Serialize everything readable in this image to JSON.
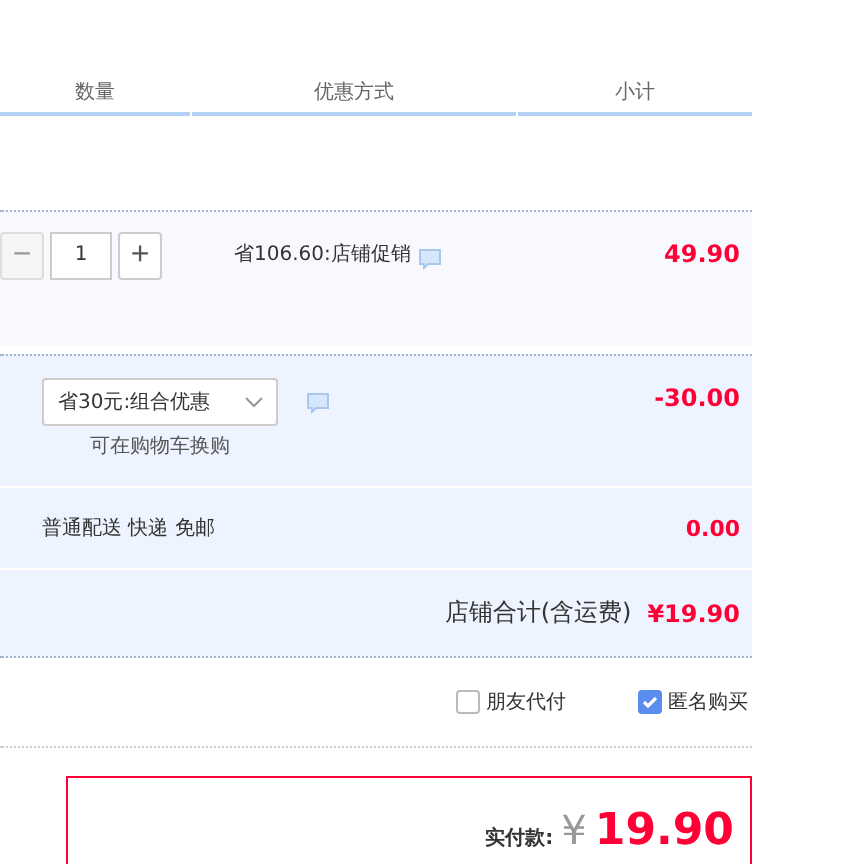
{
  "columns": [
    {
      "label": "数量"
    },
    {
      "label": "优惠方式"
    },
    {
      "label": "小计"
    }
  ],
  "item": {
    "minus": "−",
    "quantity": "1",
    "plus": "+",
    "minus_disabled": true,
    "promo": "省106.60:店铺促销",
    "subtotal": "49.90"
  },
  "combo": {
    "selection": "省30元:组合优惠",
    "note": "可在购物车换购",
    "amount": "-30.00"
  },
  "shipping": {
    "label": "普通配送 快递 免邮",
    "amount": "0.00"
  },
  "shop_total": {
    "label": "店铺合计(含运费)",
    "amount": "¥19.90"
  },
  "options": [
    {
      "label": "朋友代付",
      "checked": false
    },
    {
      "label": "匿名购买",
      "checked": true
    }
  ],
  "payment": {
    "label": "实付款:",
    "currency": "¥",
    "amount": "19.90"
  }
}
